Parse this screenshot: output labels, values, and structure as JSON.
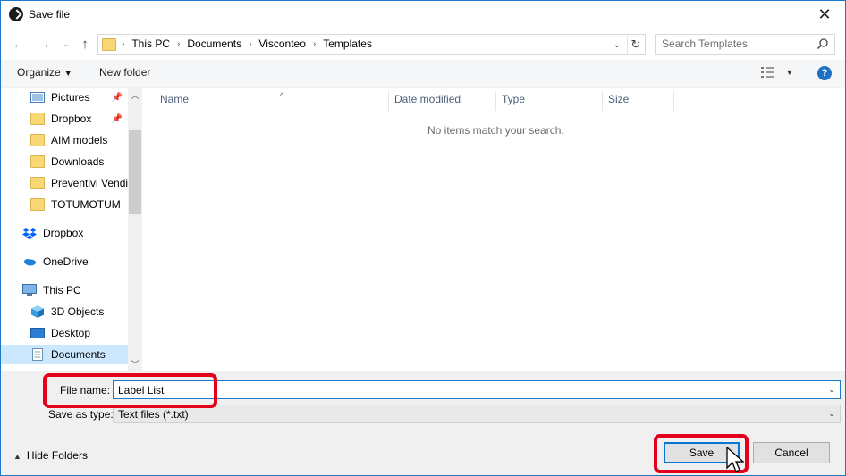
{
  "window": {
    "title": "Save file"
  },
  "address": {
    "crumbs": [
      "This PC",
      "Documents",
      "Visconteo",
      "Templates"
    ]
  },
  "search": {
    "placeholder": "Search Templates"
  },
  "toolbar": {
    "organize": "Organize",
    "new_folder": "New folder",
    "help": "?"
  },
  "sidebar": {
    "items": [
      {
        "label": "Pictures",
        "icon": "pictures-icon",
        "pinned": true
      },
      {
        "label": "Dropbox",
        "icon": "dropbox-folder-icon",
        "pinned": true
      },
      {
        "label": "AIM models",
        "icon": "folder-icon"
      },
      {
        "label": "Downloads",
        "icon": "folder-icon"
      },
      {
        "label": "Preventivi Vendit",
        "icon": "folder-icon"
      },
      {
        "label": "TOTUMOTUM",
        "icon": "folder-icon"
      },
      {
        "label": "Dropbox",
        "icon": "dropbox-icon"
      },
      {
        "label": "OneDrive",
        "icon": "onedrive-icon"
      },
      {
        "label": "This PC",
        "icon": "this-pc-icon"
      },
      {
        "label": "3D Objects",
        "icon": "3d-objects-icon"
      },
      {
        "label": "Desktop",
        "icon": "desktop-icon"
      },
      {
        "label": "Documents",
        "icon": "documents-icon",
        "selected": true
      }
    ]
  },
  "columns": [
    "Name",
    "Date modified",
    "Type",
    "Size"
  ],
  "empty_message": "No items match your search.",
  "form": {
    "file_name_label": "File name:",
    "file_name_value": "Label List",
    "save_as_type_label": "Save as type:",
    "save_as_type_value": "Text files (*.txt)"
  },
  "footer": {
    "hide_folders": "Hide Folders",
    "save": "Save",
    "cancel": "Cancel"
  },
  "colors": {
    "accent": "#0078d7",
    "highlight": "#e3001b",
    "selected": "#cce8ff"
  }
}
